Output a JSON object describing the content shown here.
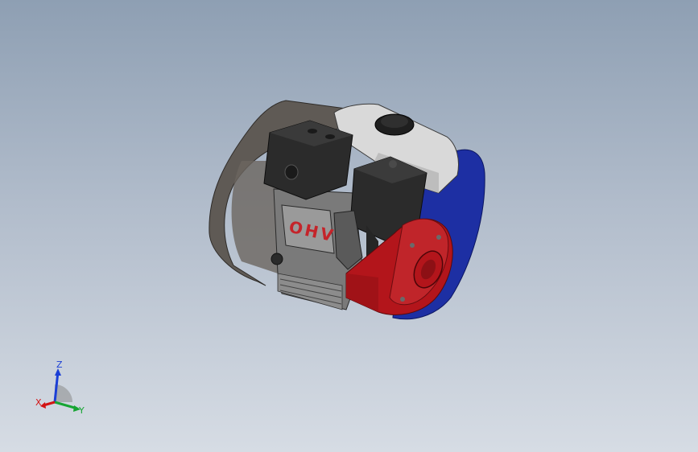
{
  "viewport": {
    "background_top": "#8e9fb3",
    "background_bottom": "#d6dce4"
  },
  "model": {
    "engraving": "OHV",
    "colors": {
      "shroud": "#5f5a55",
      "tank": "#d9d9d9",
      "black_parts": "#2b2b2b",
      "recoil_housing": "#b3151b",
      "rear_cover": "#1d2fa3",
      "block": "#7a7a7a"
    }
  },
  "triad": {
    "z_label": "Z",
    "x_label": "X",
    "y_label": "Y",
    "z_color": "#1b3fd6",
    "x_color": "#d21414",
    "y_color": "#17a533"
  }
}
